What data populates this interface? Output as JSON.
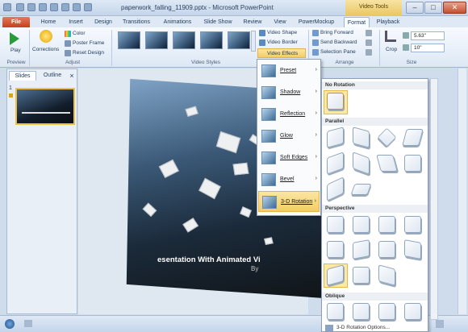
{
  "window": {
    "title": "paperwork_falling_11909.pptx - Microsoft PowerPoint",
    "contextual_tab": "Video Tools",
    "minimize": "–",
    "maximize": "□",
    "close": "✕"
  },
  "tabs": [
    "File",
    "Home",
    "Insert",
    "Design",
    "Transitions",
    "Animations",
    "Slide Show",
    "Review",
    "View",
    "PowerMockup",
    "Format",
    "Playback"
  ],
  "ribbon": {
    "preview": {
      "play": "Play",
      "group": "Preview"
    },
    "adjust": {
      "corrections": "Corrections",
      "color": "Color",
      "poster_frame": "Poster Frame",
      "reset_design": "Reset Design",
      "group": "Adjust"
    },
    "video_styles": {
      "group": "Video Styles",
      "video_shape": "Video Shape",
      "video_border": "Video Border",
      "video_effects": "Video Effects"
    },
    "arrange": {
      "bring_forward": "Bring Forward",
      "send_backward": "Send Backward",
      "selection_pane": "Selection Pane",
      "group": "Arrange"
    },
    "size": {
      "crop": "Crop",
      "height": "5.63\"",
      "width": "10\"",
      "group": "Size"
    }
  },
  "panel": {
    "tab_slides": "Slides",
    "tab_outline": "Outline",
    "close": "×",
    "slide_number": "1"
  },
  "slide": {
    "title": "esentation With Animated Vi",
    "byline": "By"
  },
  "menu": {
    "items": [
      {
        "label": "Preset"
      },
      {
        "label": "Shadow"
      },
      {
        "label": "Reflection"
      },
      {
        "label": "Glow"
      },
      {
        "label": "Soft Edges"
      },
      {
        "label": "Bevel"
      },
      {
        "label": "3-D Rotation"
      }
    ],
    "arrow": "›"
  },
  "gallery": {
    "sections": [
      "No Rotation",
      "Parallel",
      "Perspective",
      "Oblique"
    ],
    "footer": "3-D Rotation Options..."
  }
}
